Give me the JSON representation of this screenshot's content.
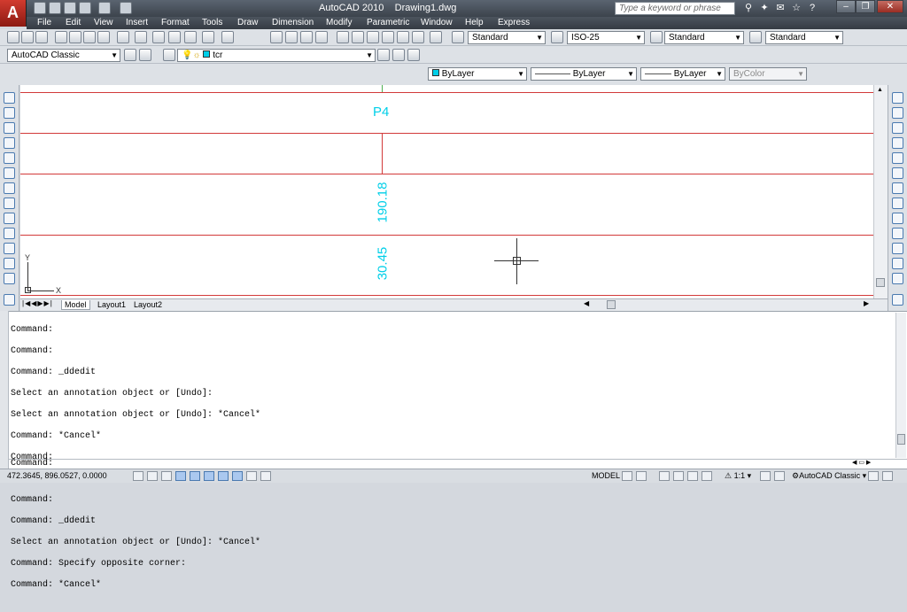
{
  "app": {
    "title": "AutoCAD 2010",
    "document": "Drawing1.dwg",
    "search_placeholder": "Type a keyword or phrase",
    "logo_letter": "A"
  },
  "menu": [
    "File",
    "Edit",
    "View",
    "Insert",
    "Format",
    "Tools",
    "Draw",
    "Dimension",
    "Modify",
    "Parametric",
    "Window",
    "Help",
    "Express"
  ],
  "styles_toolbar": {
    "text_style": "Standard",
    "dim_style": "ISO-25",
    "table_style": "Standard",
    "multileader_style": "Standard"
  },
  "workspace": {
    "name": "AutoCAD Classic",
    "layer": "tcr"
  },
  "properties": {
    "color": "ByLayer",
    "linetype": "ByLayer",
    "lineweight": "ByLayer",
    "plotstyle": "ByColor"
  },
  "drawing": {
    "label_p4": "P4",
    "dim_1": "190.18",
    "dim_2": "30.45",
    "ucs_x": "X",
    "ucs_y": "Y",
    "line_color": "#d23a3a",
    "text_color": "#00cfe8"
  },
  "layout_tabs": [
    "Model",
    "Layout1",
    "Layout2"
  ],
  "command_history": [
    "Command:",
    "Command:",
    "Command: _ddedit",
    "Select an annotation object or [Undo]:",
    "Select an annotation object or [Undo]: *Cancel*",
    "Command: *Cancel*",
    "Command:",
    "Command:",
    "Command:",
    "Command: _ddedit",
    "Select an annotation object or [Undo]: *Cancel*",
    "Command: Specify opposite corner:",
    "Command: *Cancel*"
  ],
  "command_prompt": "Command:",
  "status": {
    "coordinates": "472.3645, 896.0527, 0.0000",
    "space": "MODEL",
    "annotation_scale": "1:1",
    "workspace": "AutoCAD Classic"
  }
}
